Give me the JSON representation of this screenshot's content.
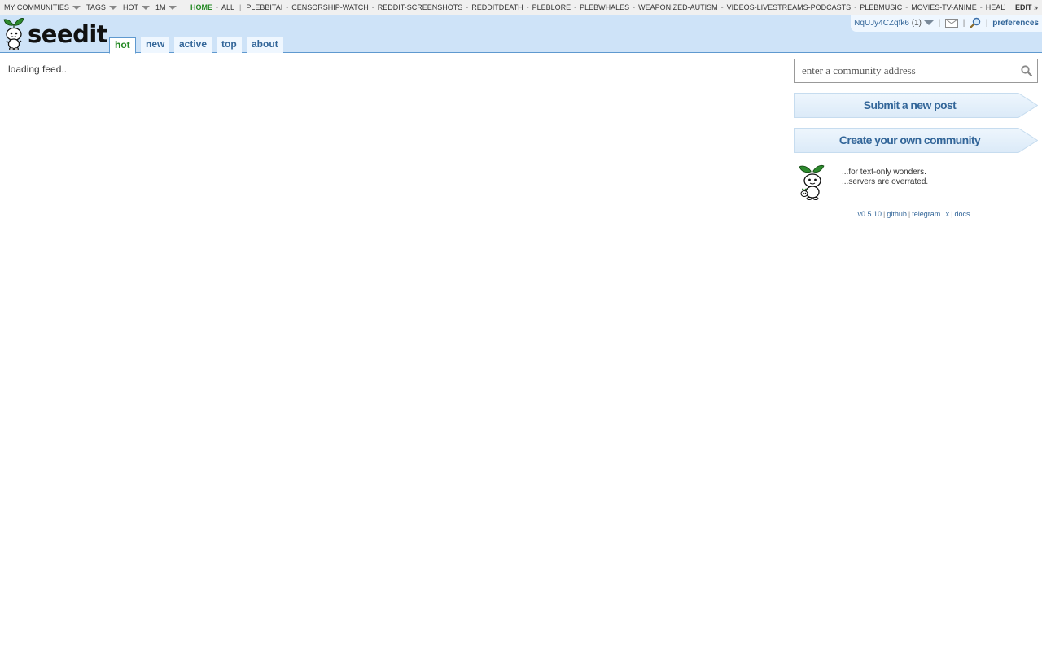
{
  "top_strip": {
    "dropdowns": [
      {
        "label": "MY COMMUNITIES"
      },
      {
        "label": "TAGS"
      },
      {
        "label": "HOT"
      },
      {
        "label": "1M"
      }
    ],
    "home": "HOME",
    "all": "ALL",
    "communities": [
      "PLEBBITAI",
      "CENSORSHIP-WATCH",
      "REDDIT-SCREENSHOTS",
      "REDDITDEATH",
      "PLEBLORE",
      "PLEBWHALES",
      "WEAPONIZED-AUTISM",
      "VIDEOS-LIVESTREAMS-PODCASTS",
      "PLEBMUSIC",
      "MOVIES-TV-ANIME",
      "HEALTH-NUTRITION-SCIENCE"
    ],
    "edit_label": "EDIT »"
  },
  "header": {
    "logo_text": "seedit",
    "tabs": [
      {
        "label": "hot",
        "selected": true
      },
      {
        "label": "new",
        "selected": false
      },
      {
        "label": "active",
        "selected": false
      },
      {
        "label": "top",
        "selected": false
      },
      {
        "label": "about",
        "selected": false
      }
    ],
    "user": {
      "username": "NqUJy4CZqfk6",
      "karma_open": "(",
      "karma": "1",
      "karma_close": ")",
      "preferences_label": "preferences",
      "mail_icon": "mail-icon",
      "search_icon": "magnifier-icon"
    }
  },
  "main": {
    "loading_text": "loading feed.."
  },
  "sidebar": {
    "search_placeholder": "enter a community address",
    "submit_label": "Submit a new post",
    "create_label": "Create your own community",
    "taglines": [
      "...for text-only wonders.",
      "...servers are overrated."
    ],
    "footer_links": [
      "v0.5.10",
      "github",
      "telegram",
      "x",
      "docs"
    ]
  },
  "colors": {
    "header_bg": "#cee3f8",
    "link_blue": "#336699",
    "selected_green": "#228822",
    "button_bg": "#e6f1fb"
  }
}
